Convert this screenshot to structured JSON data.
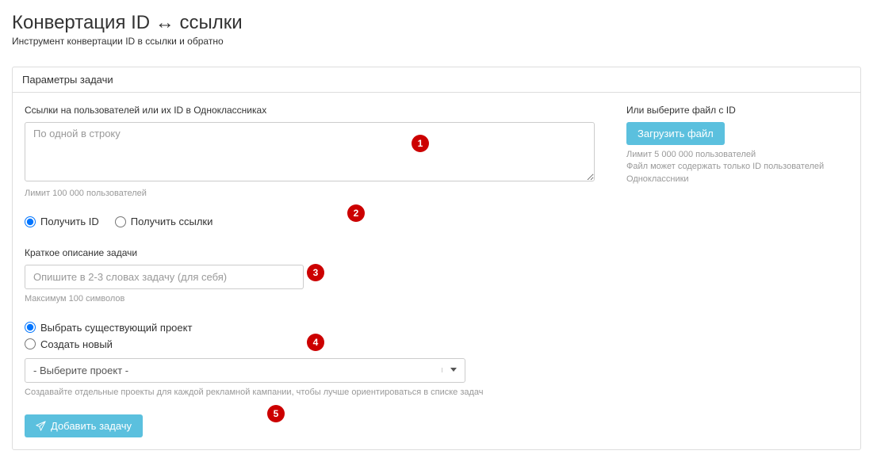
{
  "page": {
    "title": "Конвертация ID ↔ ссылки",
    "subtitle": "Инструмент конвертации ID в ссылки и обратно"
  },
  "panel": {
    "header": "Параметры задачи"
  },
  "links_field": {
    "label": "Ссылки на пользователей или их ID в Одноклассниках",
    "placeholder": "По одной в строку",
    "help": "Лимит 100 000 пользователей"
  },
  "file_field": {
    "label": "Или выберите файл с ID",
    "button": "Загрузить файл",
    "help1": "Лимит 5 000 000 пользователей",
    "help2": "Файл может содержать только ID пользователей Одноклассники"
  },
  "mode_radio": {
    "get_id": "Получить ID",
    "get_links": "Получить ссылки"
  },
  "description_field": {
    "label": "Краткое описание задачи",
    "placeholder": "Опишите в 2-3 словах задачу (для себя)",
    "help": "Максимум 100 символов"
  },
  "project_radio": {
    "existing": "Выбрать существующий проект",
    "create": "Создать новый"
  },
  "project_select": {
    "placeholder": "- Выберите проект -",
    "help": "Создавайте отдельные проекты для каждой рекламной кампании, чтобы лучше ориентироваться в списке задач"
  },
  "submit": {
    "label": "Добавить задачу"
  },
  "markers": {
    "m1": "1",
    "m2": "2",
    "m3": "3",
    "m4": "4",
    "m5": "5"
  }
}
